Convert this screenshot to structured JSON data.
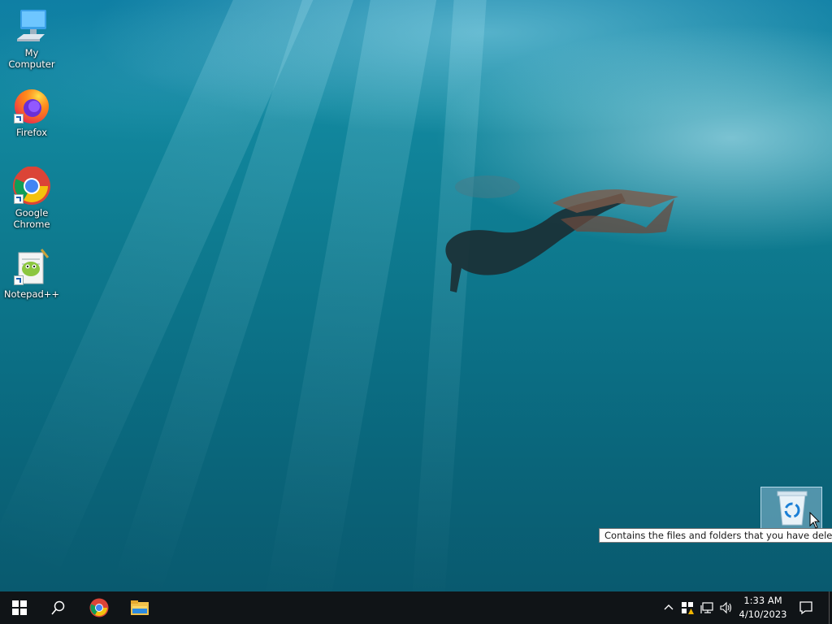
{
  "desktop": {
    "icons": [
      {
        "label": "My Computer",
        "icon": "computer-icon"
      },
      {
        "label": "Firefox",
        "icon": "firefox-icon"
      },
      {
        "label": "Google Chrome",
        "icon": "chrome-icon"
      },
      {
        "label": "Notepad++",
        "icon": "notepad-plus-plus-icon"
      }
    ],
    "recycle_bin": {
      "icon": "recycle-bin-icon"
    },
    "tooltip": "Contains the files and folders that you have deleted."
  },
  "taskbar": {
    "start": {
      "icon": "windows-start-icon"
    },
    "search": {
      "icon": "search-icon"
    },
    "pinned": [
      {
        "icon": "chrome-icon"
      },
      {
        "icon": "file-explorer-icon"
      }
    ],
    "tray": {
      "icons": [
        "chevron-up-icon",
        "security-warning-icon",
        "network-icon",
        "volume-icon"
      ],
      "time": "1:33 AM",
      "date": "4/10/2023",
      "notification_icon": "notification-icon"
    }
  },
  "colors": {
    "taskbar": "#101417",
    "water_top": "#0f7fa4",
    "water_bottom": "#095a6f",
    "tooltip_bg": "#ffffff"
  }
}
